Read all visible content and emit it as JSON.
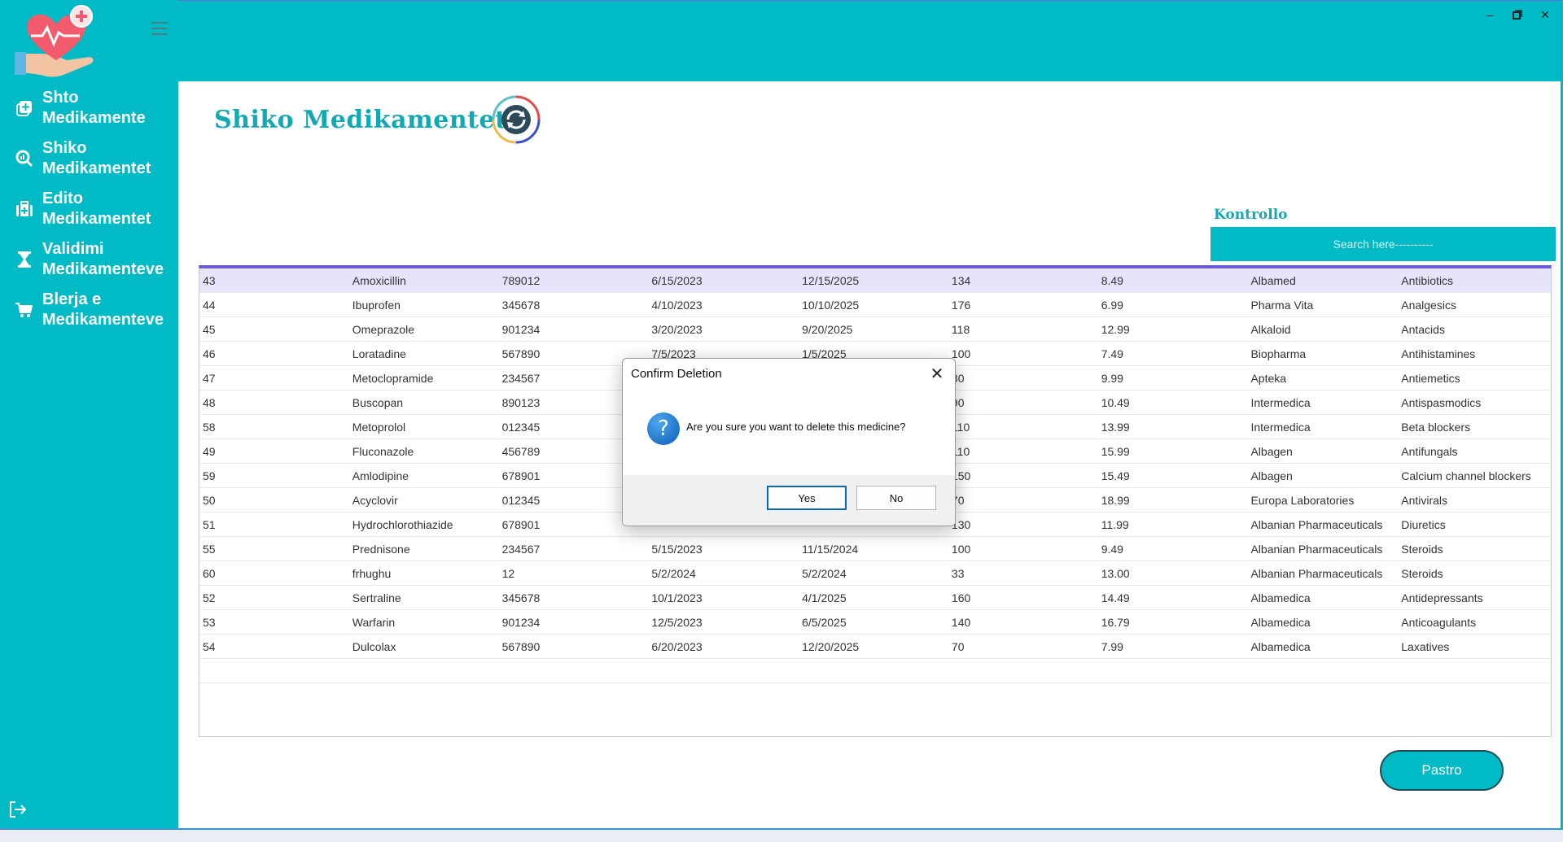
{
  "sidebar": {
    "items": [
      {
        "line1": "Shto",
        "line2": "Medikamente",
        "icon": "add-medicine-icon"
      },
      {
        "line1": "Shiko",
        "line2": "Medikamentet",
        "icon": "search-chart-icon"
      },
      {
        "line1": "Edito",
        "line2": "Medikamentet",
        "icon": "medical-kit-icon"
      },
      {
        "line1": "Validimi",
        "line2": "Medikamenteve",
        "icon": "hourglass-icon"
      },
      {
        "line1": "Blerja e",
        "line2": "Medikamenteve",
        "icon": "cart-icon"
      }
    ]
  },
  "page": {
    "title": "Shiko Medikamentet",
    "search_label": "Kontrollo",
    "search_placeholder": "Search here----------",
    "clear_button": "Pastro"
  },
  "table": {
    "rows": [
      [
        "43",
        "Amoxicillin",
        "789012",
        "6/15/2023",
        "12/15/2025",
        "134",
        "8.49",
        "Albamed",
        "Antibiotics"
      ],
      [
        "44",
        "Ibuprofen",
        "345678",
        "4/10/2023",
        "10/10/2025",
        "176",
        "6.99",
        "Pharma Vita",
        "Analgesics"
      ],
      [
        "45",
        "Omeprazole",
        "901234",
        "3/20/2023",
        "9/20/2025",
        "118",
        "12.99",
        "Alkaloid",
        "Antacids"
      ],
      [
        "46",
        "Loratadine",
        "567890",
        "7/5/2023",
        "1/5/2025",
        "100",
        "7.49",
        "Biopharma",
        "Antihistamines"
      ],
      [
        "47",
        "Metoclopramide",
        "234567",
        "",
        "",
        "30",
        "9.99",
        "Apteka",
        "Antiemetics"
      ],
      [
        "48",
        "Buscopan",
        "890123",
        "",
        "",
        "90",
        "10.49",
        "Intermedica",
        "Antispasmodics"
      ],
      [
        "58",
        "Metoprolol",
        "012345",
        "",
        "",
        "110",
        "13.99",
        "Intermedica",
        "Beta blockers"
      ],
      [
        "49",
        "Fluconazole",
        "456789",
        "",
        "",
        "110",
        "15.99",
        "Albagen",
        "Antifungals"
      ],
      [
        "59",
        "Amlodipine",
        "678901",
        "",
        "",
        "150",
        "15.49",
        "Albagen",
        "Calcium channel blockers"
      ],
      [
        "50",
        "Acyclovir",
        "012345",
        "",
        "",
        "70",
        "18.99",
        "Europa Laboratories",
        "Antivirals"
      ],
      [
        "51",
        "Hydrochlorothiazide",
        "678901",
        "",
        "",
        "130",
        "11.99",
        "Albanian Pharmaceuticals",
        "Diuretics"
      ],
      [
        "55",
        "Prednisone",
        "234567",
        "5/15/2023",
        "11/15/2024",
        "100",
        "9.49",
        "Albanian Pharmaceuticals",
        "Steroids"
      ],
      [
        "60",
        "frhughu",
        "12",
        "5/2/2024",
        "5/2/2024",
        "33",
        "13.00",
        "Albanian Pharmaceuticals",
        "Steroids"
      ],
      [
        "52",
        "Sertraline",
        "345678",
        "10/1/2023",
        "4/1/2025",
        "160",
        "14.49",
        "Albamedica",
        "Antidepressants"
      ],
      [
        "53",
        "Warfarin",
        "901234",
        "12/5/2023",
        "6/5/2025",
        "140",
        "16.79",
        "Albamedica",
        "Anticoagulants"
      ],
      [
        "54",
        "Dulcolax",
        "567890",
        "6/20/2023",
        "12/20/2025",
        "70",
        "7.99",
        "Albamedica",
        "Laxatives"
      ]
    ]
  },
  "dialog": {
    "title": "Confirm Deletion",
    "message": "Are you sure you want to delete this medicine?",
    "yes": "Yes",
    "no": "No"
  },
  "colors": {
    "accent": "#00bac5",
    "title_text": "#11a9b4",
    "selection_border": "#6d5bd6",
    "selected_row": "#e6e4fa"
  }
}
